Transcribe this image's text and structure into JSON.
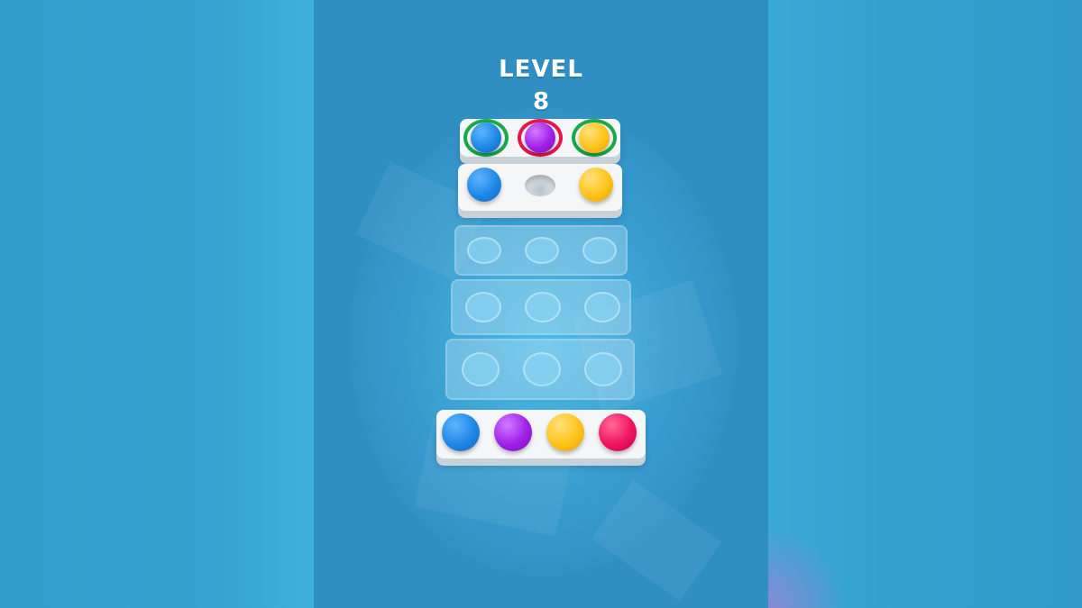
{
  "level": {
    "label": "LEVEL",
    "number": "8"
  },
  "colors": {
    "blue": "#1e88e5",
    "purple": "#a020e8",
    "yellow": "#ffc21a",
    "pink": "#f0145e",
    "ring_green": "#1aa84a",
    "ring_red": "#e0184e"
  },
  "board": {
    "target_row": [
      "blue",
      "purple",
      "yellow"
    ],
    "target_ring_colors": [
      "green",
      "red",
      "green"
    ],
    "row_2": [
      "blue",
      "empty",
      "yellow"
    ],
    "ghost_rows": 3,
    "ghost_slots_per_row": 3,
    "bottom_row": [
      "blue",
      "purple",
      "yellow",
      "pink"
    ]
  }
}
